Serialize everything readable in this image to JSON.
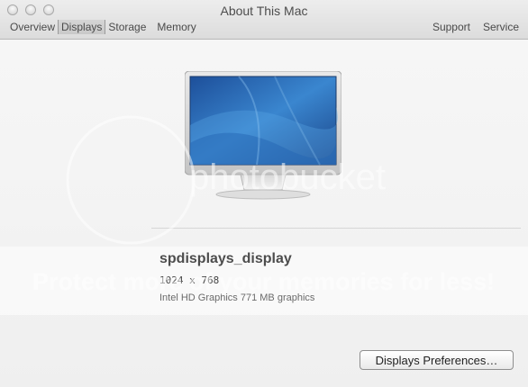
{
  "window": {
    "title": "About This Mac",
    "controls": [
      "close",
      "minimize",
      "zoom"
    ]
  },
  "tabs": [
    {
      "label": "Overview",
      "selected": false
    },
    {
      "label": "Displays",
      "selected": true
    },
    {
      "label": "Storage",
      "selected": false
    },
    {
      "label": "Memory",
      "selected": false
    }
  ],
  "links": {
    "support": "Support",
    "service": "Service"
  },
  "display": {
    "name": "spdisplays_display",
    "resolution": "1024 x 768",
    "graphics": "Intel HD Graphics 771 MB graphics",
    "icon": "monitor-icon"
  },
  "buttons": {
    "preferences": "Displays Preferences…"
  },
  "watermark": {
    "logo_text": "photobucket",
    "tagline": "Protect more of your memories for less!"
  },
  "colors": {
    "window_bg": "#ececec",
    "screen_blue": "#2f79c3"
  }
}
